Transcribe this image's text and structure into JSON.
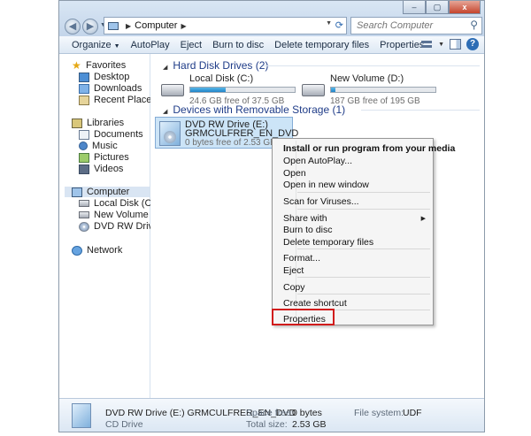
{
  "address": {
    "crumb": "Computer",
    "search_placeholder": "Search Computer"
  },
  "window_controls": {
    "minimize": "–",
    "maximize": "▢",
    "close": "x"
  },
  "toolbar": {
    "organize": "Organize",
    "autoplay": "AutoPlay",
    "eject": "Eject",
    "burn": "Burn to disc",
    "delete_temp": "Delete temporary files",
    "properties": "Properties"
  },
  "nav": {
    "favorites": "Favorites",
    "desktop": "Desktop",
    "downloads": "Downloads",
    "recent": "Recent Places",
    "libraries": "Libraries",
    "documents": "Documents",
    "music": "Music",
    "pictures": "Pictures",
    "videos": "Videos",
    "computer": "Computer",
    "local_disk": "Local Disk (C:)",
    "new_volume": "New Volume (D:)",
    "dvd": "DVD RW Drive (E:) G",
    "network": "Network"
  },
  "content": {
    "hdd_header": "Hard Disk Drives (2)",
    "removable_header": "Devices with Removable Storage (1)",
    "drive_c": {
      "name": "Local Disk (C:)",
      "free": "24.6 GB free of 37.5 GB",
      "used_fraction": 0.34
    },
    "drive_d": {
      "name": "New Volume (D:)",
      "free": "187 GB free of 195 GB",
      "used_fraction": 0.04
    },
    "dvd": {
      "name": "DVD RW Drive (E:)",
      "label": "GRMCULFRER_EN_DVD",
      "free": "0 bytes free of 2.53 GB"
    }
  },
  "context_menu": {
    "install": "Install or run program from your media",
    "open_autoplay": "Open AutoPlay...",
    "open": "Open",
    "open_new_window": "Open in new window",
    "scan": "Scan for Viruses...",
    "share_with": "Share with",
    "burn": "Burn to disc",
    "delete_temp": "Delete temporary files",
    "format": "Format...",
    "eject": "Eject",
    "copy": "Copy",
    "create_shortcut": "Create shortcut",
    "properties": "Properties"
  },
  "details": {
    "title": "DVD RW Drive (E:) GRMCULFRER_EN_DVD",
    "subtitle": "CD Drive",
    "space_free_label": "Space free:",
    "space_free_value": "0 bytes",
    "total_size_label": "Total size:",
    "total_size_value": "2.53 GB",
    "fs_label": "File system:",
    "fs_value": "UDF"
  },
  "colors": {
    "highlight_box": "#d11c1c",
    "group_header": "#1f3c88"
  }
}
